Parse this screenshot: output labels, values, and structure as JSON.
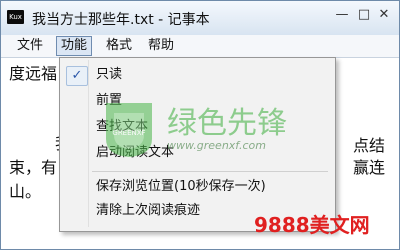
{
  "window": {
    "app_icon_text": "Kux",
    "title": "我当方士那些年.txt - 记事本",
    "min_glyph": "—",
    "max_glyph": "□",
    "close_glyph": "✕"
  },
  "menubar": {
    "file": "文件",
    "function": "功能",
    "format": "格式",
    "help": "帮助"
  },
  "document": {
    "line1": "度远福",
    "line2": "我",
    "line3": "束，有",
    "line4": "山。",
    "right1": "点结",
    "right2": "赢连"
  },
  "dropdown": {
    "items": [
      {
        "label": "只读",
        "checked": true
      },
      {
        "label": "前置",
        "checked": false
      },
      {
        "label": "查找文本",
        "checked": false
      },
      {
        "label": "启动阅读文本",
        "checked": false
      },
      {
        "label": "保存浏览位置(10秒保存一次)",
        "checked": false
      },
      {
        "label": "清除上次阅读痕迹",
        "checked": false
      }
    ],
    "check_glyph": "✓"
  },
  "watermark": {
    "logo_text": "GREENXF",
    "name": "绿色先锋",
    "url": "www.greenxf.com",
    "badge": "9888美文网",
    "colors": {
      "green": "#3cae3c",
      "red": "#e02020"
    }
  }
}
